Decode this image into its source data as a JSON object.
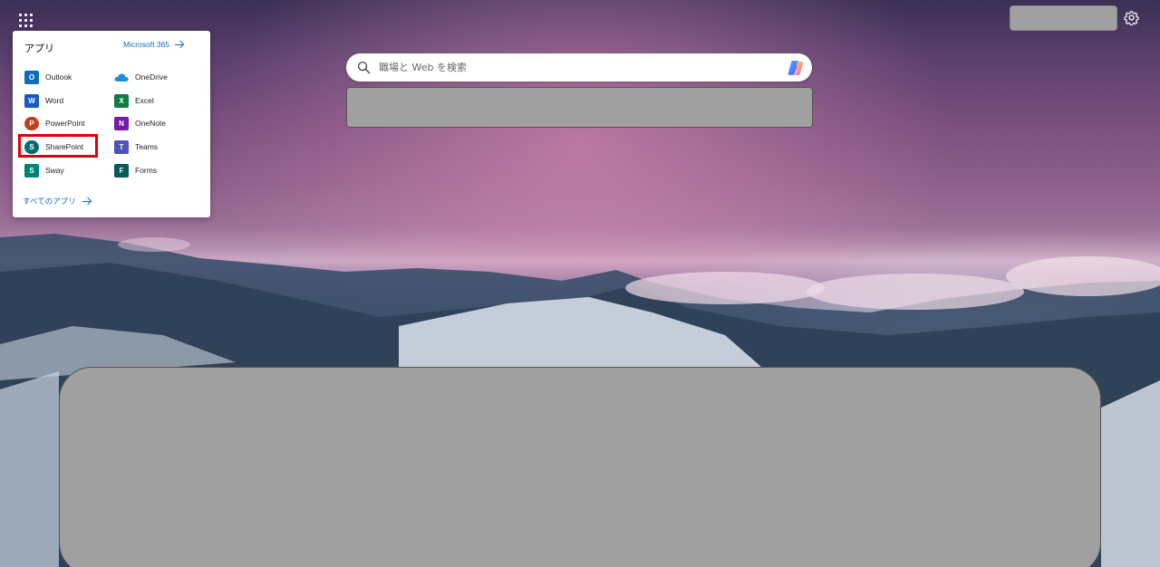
{
  "apps_panel": {
    "title": "アプリ",
    "m365_link": "Microsoft 365",
    "all_apps_link": "すべてのアプリ",
    "apps": [
      {
        "label": "Outlook",
        "icon": "outlook-icon",
        "color": "#0f6cbd",
        "letter": "O"
      },
      {
        "label": "OneDrive",
        "icon": "onedrive-icon",
        "color": "#1a8fe3",
        "letter": ""
      },
      {
        "label": "Word",
        "icon": "word-icon",
        "color": "#185abd",
        "letter": "W"
      },
      {
        "label": "Excel",
        "icon": "excel-icon",
        "color": "#107c41",
        "letter": "X"
      },
      {
        "label": "PowerPoint",
        "icon": "powerpoint-icon",
        "color": "#c43e1c",
        "letter": "P"
      },
      {
        "label": "OneNote",
        "icon": "onenote-icon",
        "color": "#7719aa",
        "letter": "N"
      },
      {
        "label": "SharePoint",
        "icon": "sharepoint-icon",
        "color": "#036c70",
        "letter": "S"
      },
      {
        "label": "Teams",
        "icon": "teams-icon",
        "color": "#4b53bc",
        "letter": "T"
      },
      {
        "label": "Sway",
        "icon": "sway-icon",
        "color": "#008272",
        "letter": "S"
      },
      {
        "label": "Forms",
        "icon": "forms-icon",
        "color": "#035b5e",
        "letter": "F"
      }
    ]
  },
  "search": {
    "placeholder": "職場と Web を検索",
    "value": ""
  },
  "colors": {
    "accent": "#0f6cbd",
    "highlight": "#e00000",
    "redacted": "#a0a0a0"
  }
}
